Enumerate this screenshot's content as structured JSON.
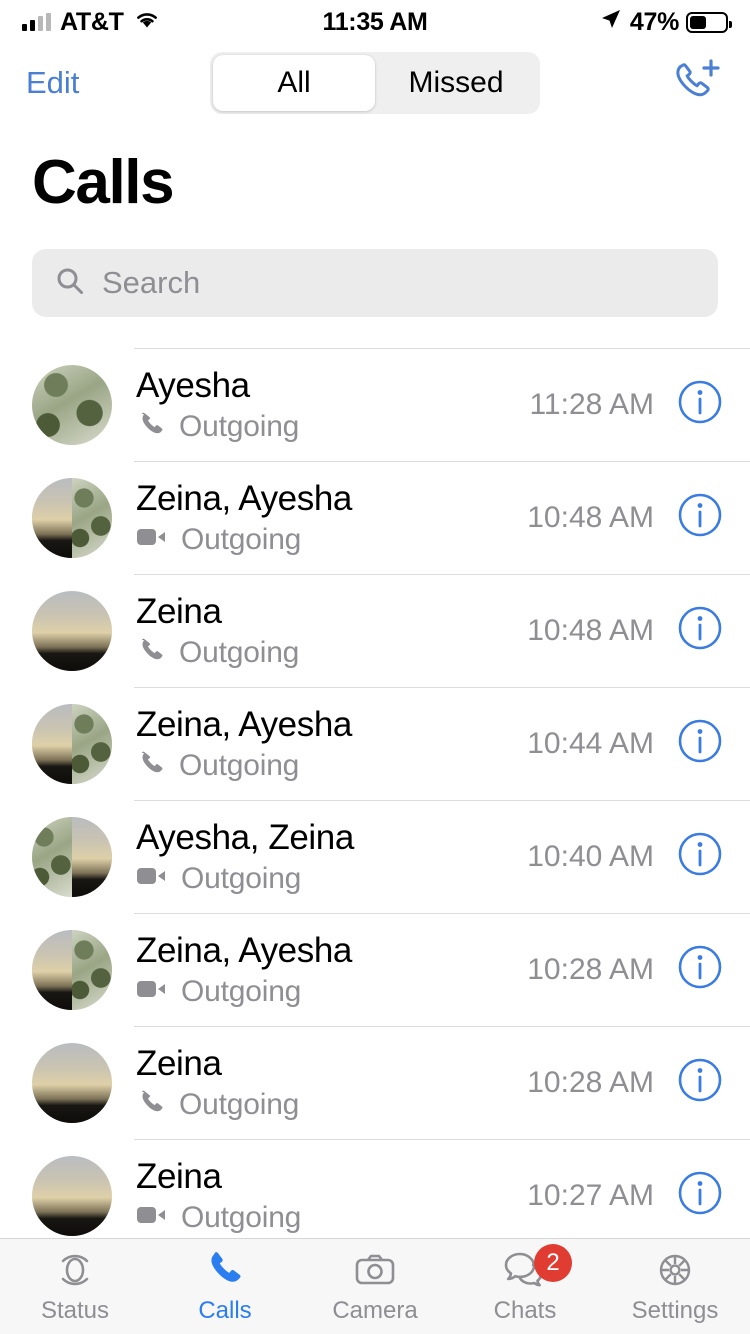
{
  "status_bar": {
    "carrier": "AT&T",
    "time": "11:35 AM",
    "battery_percent": "47%",
    "battery_level": 47,
    "signal_bars_filled": 2,
    "wifi_icon": "wifi-icon",
    "location_icon": "location-arrow-icon"
  },
  "nav": {
    "edit_label": "Edit",
    "segments": [
      {
        "label": "All",
        "selected": true
      },
      {
        "label": "Missed",
        "selected": false
      }
    ],
    "new_call_icon": "phone-plus-icon"
  },
  "page_title": "Calls",
  "search": {
    "placeholder": "Search",
    "value": "",
    "icon": "search-icon"
  },
  "calls": [
    {
      "name": "Ayesha",
      "type": "Outgoing",
      "type_icon": "phone-icon",
      "time": "11:28 AM",
      "group": false,
      "avatar": [
        "green"
      ]
    },
    {
      "name": "Zeina, Ayesha",
      "type": "Outgoing",
      "type_icon": "video-icon",
      "time": "10:48 AM",
      "group": true,
      "avatar": [
        "sunset",
        "green"
      ]
    },
    {
      "name": "Zeina",
      "type": "Outgoing",
      "type_icon": "phone-icon",
      "time": "10:48 AM",
      "group": false,
      "avatar": [
        "sunset"
      ]
    },
    {
      "name": "Zeina, Ayesha",
      "type": "Outgoing",
      "type_icon": "phone-icon",
      "time": "10:44 AM",
      "group": true,
      "avatar": [
        "sunset",
        "green"
      ]
    },
    {
      "name": "Ayesha, Zeina",
      "type": "Outgoing",
      "type_icon": "video-icon",
      "time": "10:40 AM",
      "group": true,
      "avatar": [
        "green",
        "sunset"
      ]
    },
    {
      "name": "Zeina, Ayesha",
      "type": "Outgoing",
      "type_icon": "video-icon",
      "time": "10:28 AM",
      "group": true,
      "avatar": [
        "sunset",
        "green"
      ]
    },
    {
      "name": "Zeina",
      "type": "Outgoing",
      "type_icon": "phone-icon",
      "time": "10:28 AM",
      "group": false,
      "avatar": [
        "sunset"
      ]
    },
    {
      "name": "Zeina",
      "type": "Outgoing",
      "type_icon": "video-icon",
      "time": "10:27 AM",
      "group": false,
      "avatar": [
        "sunset"
      ]
    }
  ],
  "info_button_label": "i",
  "tabs": [
    {
      "label": "Status",
      "icon": "status-rings-icon",
      "active": false,
      "badge": null
    },
    {
      "label": "Calls",
      "icon": "phone-icon",
      "active": true,
      "badge": null
    },
    {
      "label": "Camera",
      "icon": "camera-icon",
      "active": false,
      "badge": null
    },
    {
      "label": "Chats",
      "icon": "chats-bubbles-icon",
      "active": false,
      "badge": "2"
    },
    {
      "label": "Settings",
      "icon": "gear-icon",
      "active": false,
      "badge": null
    }
  ],
  "colors": {
    "accent_blue": "#2a7ef0",
    "edit_blue": "#4a7fd4",
    "badge_red": "#e03c31",
    "secondary_gray": "#8e8e93",
    "search_bg": "#ebebec",
    "tabbar_bg": "#f7f7f7"
  }
}
